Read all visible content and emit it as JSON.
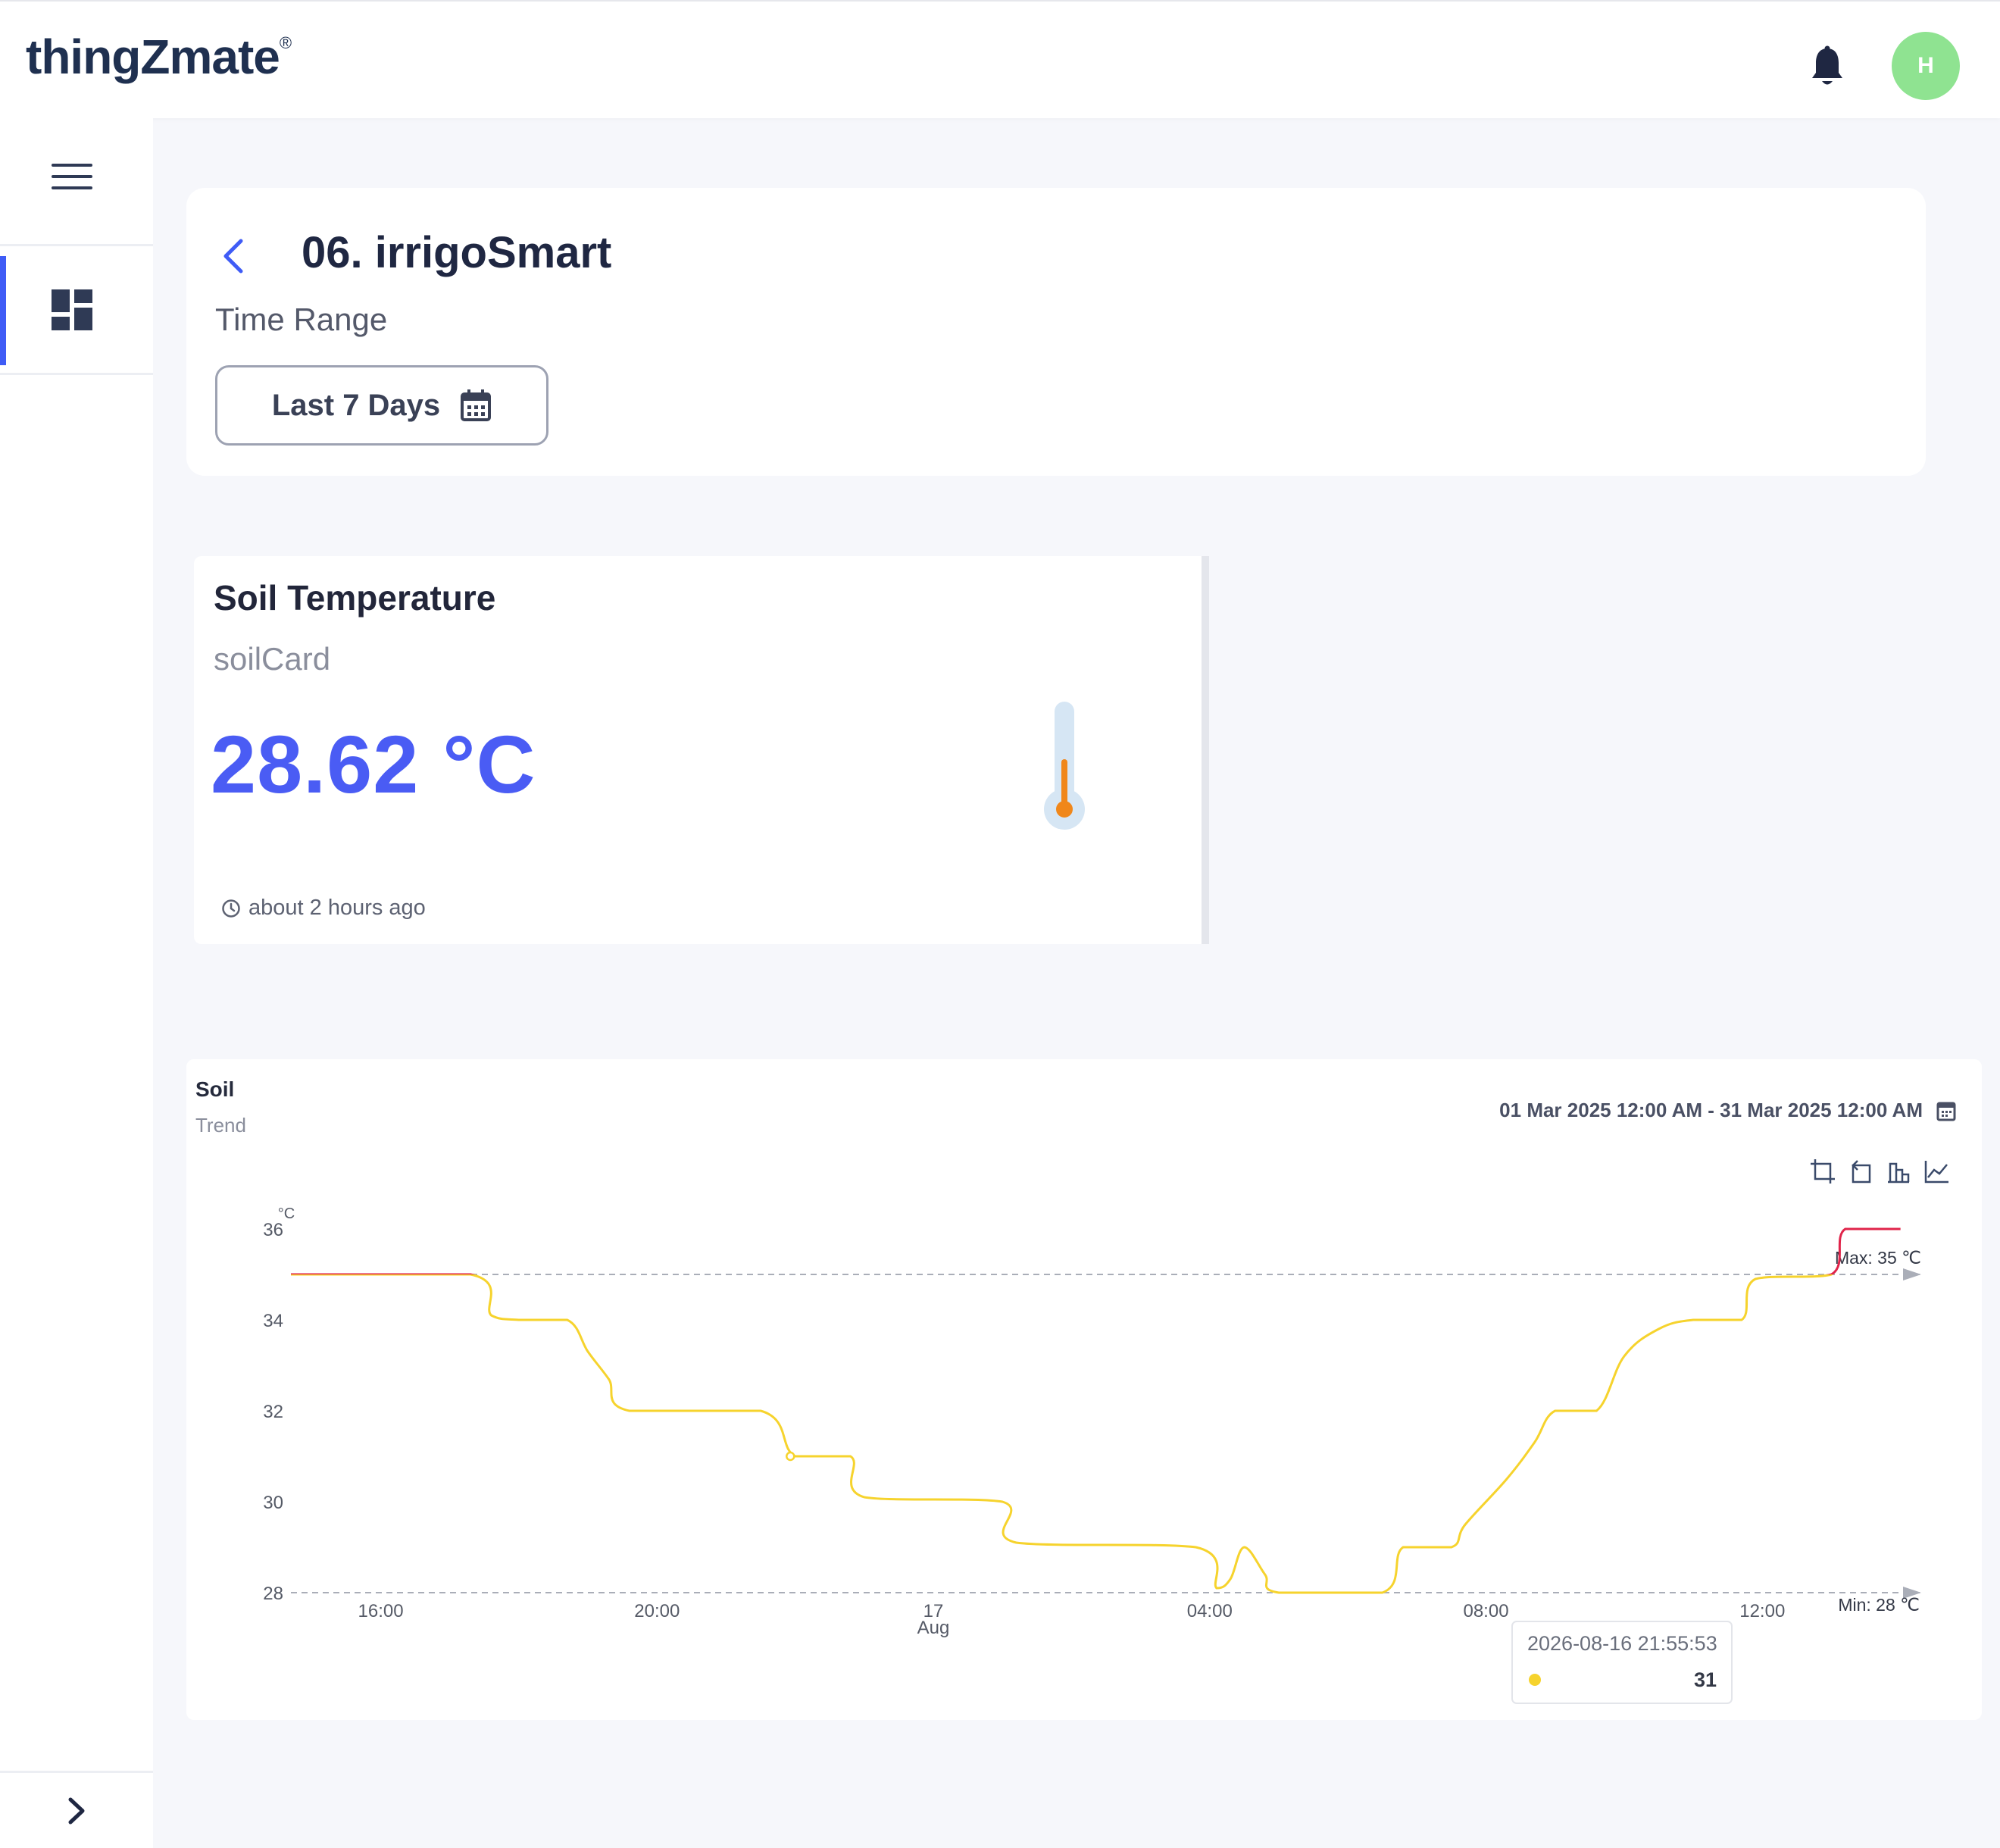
{
  "app": {
    "logo_text": "thingZmate",
    "logo_mark": "®",
    "user_initial": "H",
    "avatar_color": "#8fe391"
  },
  "header": {
    "title": "06. irrigoSmart",
    "time_range_label": "Time Range",
    "time_range_value": "Last 7 Days"
  },
  "soil_card": {
    "title": "Soil Temperature",
    "subtitle": "soilCard",
    "value": "28.62 °C",
    "updated": "about 2 hours ago",
    "value_color": "#4a5cf4"
  },
  "chart_panel": {
    "title": "Soil",
    "subtitle": "Trend",
    "date_range": "01 Mar 2025 12:00 AM - 31 Mar 2025 12:00 AM",
    "toolbar": [
      "crop-icon",
      "undo-zoom-icon",
      "bar-chart-icon",
      "line-chart-icon"
    ]
  },
  "chart_data": {
    "type": "line",
    "ylabel": "°C",
    "ylim": [
      28,
      36
    ],
    "yticks": [
      28,
      30,
      32,
      34,
      36
    ],
    "x_range_hours": [
      14.7,
      38.3
    ],
    "xticks": [
      {
        "h": 16,
        "label": "16:00",
        "sub": ""
      },
      {
        "h": 20,
        "label": "20:00",
        "sub": ""
      },
      {
        "h": 24,
        "label": "17",
        "sub": "Aug"
      },
      {
        "h": 28,
        "label": "04:00",
        "sub": ""
      },
      {
        "h": 32,
        "label": "08:00",
        "sub": ""
      },
      {
        "h": 36,
        "label": "12:00",
        "sub": ""
      }
    ],
    "series": [
      {
        "color": "#f6d32d",
        "above_color": "#e0244a",
        "points": [
          [
            14.7,
            35
          ],
          [
            17.3,
            35
          ],
          [
            17.6,
            34.1
          ],
          [
            18.0,
            34
          ],
          [
            18.7,
            34
          ],
          [
            19.0,
            33.3
          ],
          [
            19.3,
            32.7
          ],
          [
            19.6,
            32
          ],
          [
            21.5,
            32
          ],
          [
            22.0,
            31
          ],
          [
            22.8,
            31
          ],
          [
            23.0,
            30.1
          ],
          [
            25.0,
            30
          ],
          [
            25.2,
            29.1
          ],
          [
            27.8,
            29
          ],
          [
            28.1,
            28.1
          ],
          [
            28.3,
            28.3
          ],
          [
            28.5,
            29
          ],
          [
            28.8,
            28.4
          ],
          [
            29.0,
            28
          ],
          [
            30.5,
            28
          ],
          [
            30.8,
            29
          ],
          [
            31.5,
            29
          ],
          [
            31.7,
            29.5
          ],
          [
            32.3,
            30.5
          ],
          [
            32.7,
            31.3
          ],
          [
            33.0,
            32
          ],
          [
            33.6,
            32
          ],
          [
            34.0,
            33.2
          ],
          [
            34.5,
            33.8
          ],
          [
            35.0,
            34
          ],
          [
            35.7,
            34
          ],
          [
            35.9,
            34.9
          ],
          [
            37.0,
            35
          ],
          [
            37.2,
            36
          ],
          [
            38.0,
            36
          ]
        ]
      }
    ],
    "markline_max": {
      "label": "Max: 35 ℃",
      "value": 35
    },
    "markline_min": {
      "label": "Min: 28 ℃",
      "value": 28
    },
    "tooltip": {
      "time": "2026-08-16 21:55:53",
      "value": "31"
    },
    "grid": false,
    "legend": "none"
  }
}
